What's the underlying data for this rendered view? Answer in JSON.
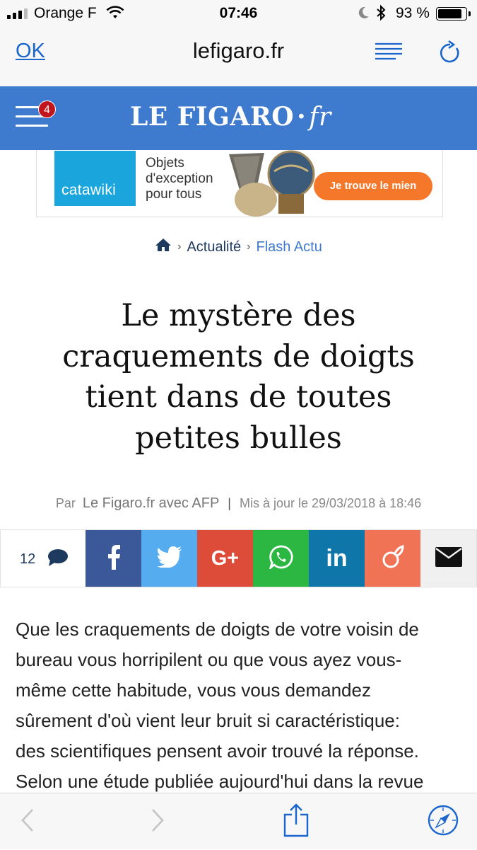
{
  "status": {
    "carrier": "Orange F",
    "time": "07:46",
    "battery": "93 %",
    "battery_level": 0.93
  },
  "browser": {
    "done_label": "OK",
    "domain": "lefigaro.fr"
  },
  "site": {
    "logo_main": "LE FIGARO",
    "logo_dot": "·",
    "logo_fr": "fr",
    "menu_badge": "4",
    "brand_color": "#3e7acd"
  },
  "ad": {
    "brand": "catawiki",
    "line1": "Objets",
    "line2": "d'exception",
    "line3": "pour tous",
    "cta": "Je trouve le mien",
    "cta_color": "#f5772a"
  },
  "breadcrumb": {
    "items": [
      "Actualité",
      "Flash Actu"
    ]
  },
  "article": {
    "title_lines": [
      "Le mystère des",
      "craquements de doigts",
      "tient dans de toutes",
      "petites bulles"
    ],
    "by_prefix": "Par",
    "author": "Le Figaro.fr avec AFP",
    "separator": "|",
    "updated": "Mis à jour le 29/03/2018 à 18:46",
    "comment_count": "12",
    "body_lines": [
      "Que les craquements de doigts de votre voisin de",
      "bureau vous horripilent ou que vous ayez vous-",
      "même cette habitude, vous vous demandez",
      "sûrement d'où vient leur bruit si caractéristique:",
      "des scientifiques pensent avoir trouvé la réponse.",
      "Selon une étude publiée aujourd'hui dans la revue"
    ]
  },
  "share_buttons": [
    {
      "icon": "facebook-icon",
      "color": "#3b5998"
    },
    {
      "icon": "twitter-icon",
      "color": "#55acee"
    },
    {
      "icon": "google-plus-icon",
      "color": "#dd4b39"
    },
    {
      "icon": "whatsapp-icon",
      "color": "#2cb742"
    },
    {
      "icon": "linkedin-icon",
      "color": "#0e76a8"
    },
    {
      "icon": "viadeo-icon",
      "color": "#f07355"
    },
    {
      "icon": "mail-icon",
      "color": "#f0f0f0"
    }
  ]
}
